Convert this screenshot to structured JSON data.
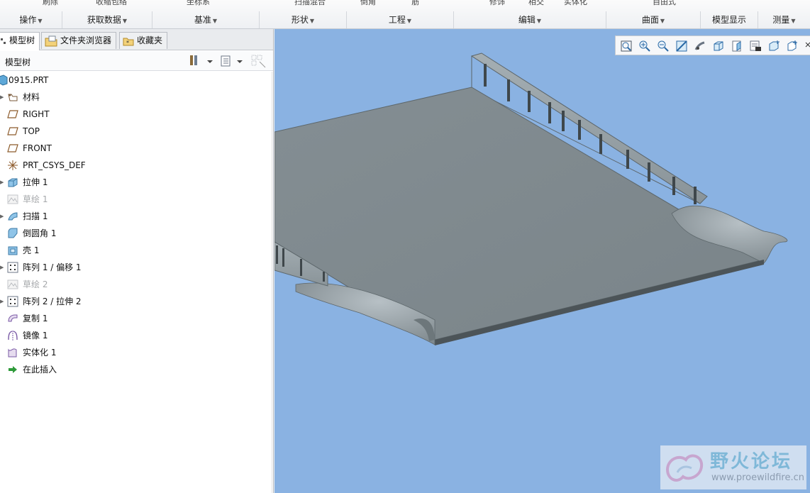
{
  "ribbon": {
    "top_fragments": [
      "刷除",
      "收缩包络",
      "坐标系",
      "扫描混合",
      "倒角",
      "筋",
      "修饰",
      "相交",
      "实体化",
      "自由式"
    ],
    "groups": [
      {
        "label": "操作"
      },
      {
        "label": "获取数据"
      },
      {
        "label": "基准"
      },
      {
        "label": "形状"
      },
      {
        "label": "工程"
      },
      {
        "label": "编辑"
      },
      {
        "label": "曲面"
      },
      {
        "label": "模型显示"
      },
      {
        "label": "测量"
      }
    ]
  },
  "tabs": [
    {
      "label": "模型树",
      "icon": "model-tree-icon"
    },
    {
      "label": "文件夹浏览器",
      "icon": "folder-browser-icon"
    },
    {
      "label": "收藏夹",
      "icon": "favorites-icon"
    }
  ],
  "tree": {
    "title": "模型树",
    "items": [
      {
        "label": "0915.PRT",
        "icon": "part-icon"
      },
      {
        "label": "材料",
        "icon": "material-icon"
      },
      {
        "label": "RIGHT",
        "icon": "datum-plane-icon"
      },
      {
        "label": "TOP",
        "icon": "datum-plane-icon"
      },
      {
        "label": "FRONT",
        "icon": "datum-plane-icon"
      },
      {
        "label": "PRT_CSYS_DEF",
        "icon": "csys-icon"
      },
      {
        "label": "拉伸 1",
        "icon": "extrude-icon"
      },
      {
        "label": "草绘 1",
        "icon": "sketch-icon"
      },
      {
        "label": "扫描 1",
        "icon": "sweep-icon"
      },
      {
        "label": "倒圆角 1",
        "icon": "round-icon"
      },
      {
        "label": "壳 1",
        "icon": "shell-icon"
      },
      {
        "label": "阵列 1 / 偏移 1",
        "icon": "pattern-icon"
      },
      {
        "label": "草绘 2",
        "icon": "sketch-icon"
      },
      {
        "label": "阵列 2 / 拉伸 2",
        "icon": "pattern-icon"
      },
      {
        "label": "复制 1",
        "icon": "copy-icon"
      },
      {
        "label": "镜像 1",
        "icon": "mirror-icon"
      },
      {
        "label": "实体化 1",
        "icon": "solidify-icon"
      },
      {
        "label": "在此插入",
        "icon": "insert-here-icon"
      }
    ]
  },
  "view_toolbar": [
    "refit-icon",
    "zoom-in-icon",
    "zoom-out-icon",
    "repaint-icon",
    "spin-center-icon",
    "shading-icon",
    "saved-views-icon",
    "view-manager-icon",
    "datum-display-icon",
    "annotation-display-icon",
    "more-icon"
  ],
  "watermark": {
    "title": "野火论坛",
    "url": "www.proewildfire.cn"
  },
  "colors": {
    "viewport_bg": "#8ab2e2",
    "model_gray": "#7f8a8f",
    "model_edge": "#4c5458"
  }
}
